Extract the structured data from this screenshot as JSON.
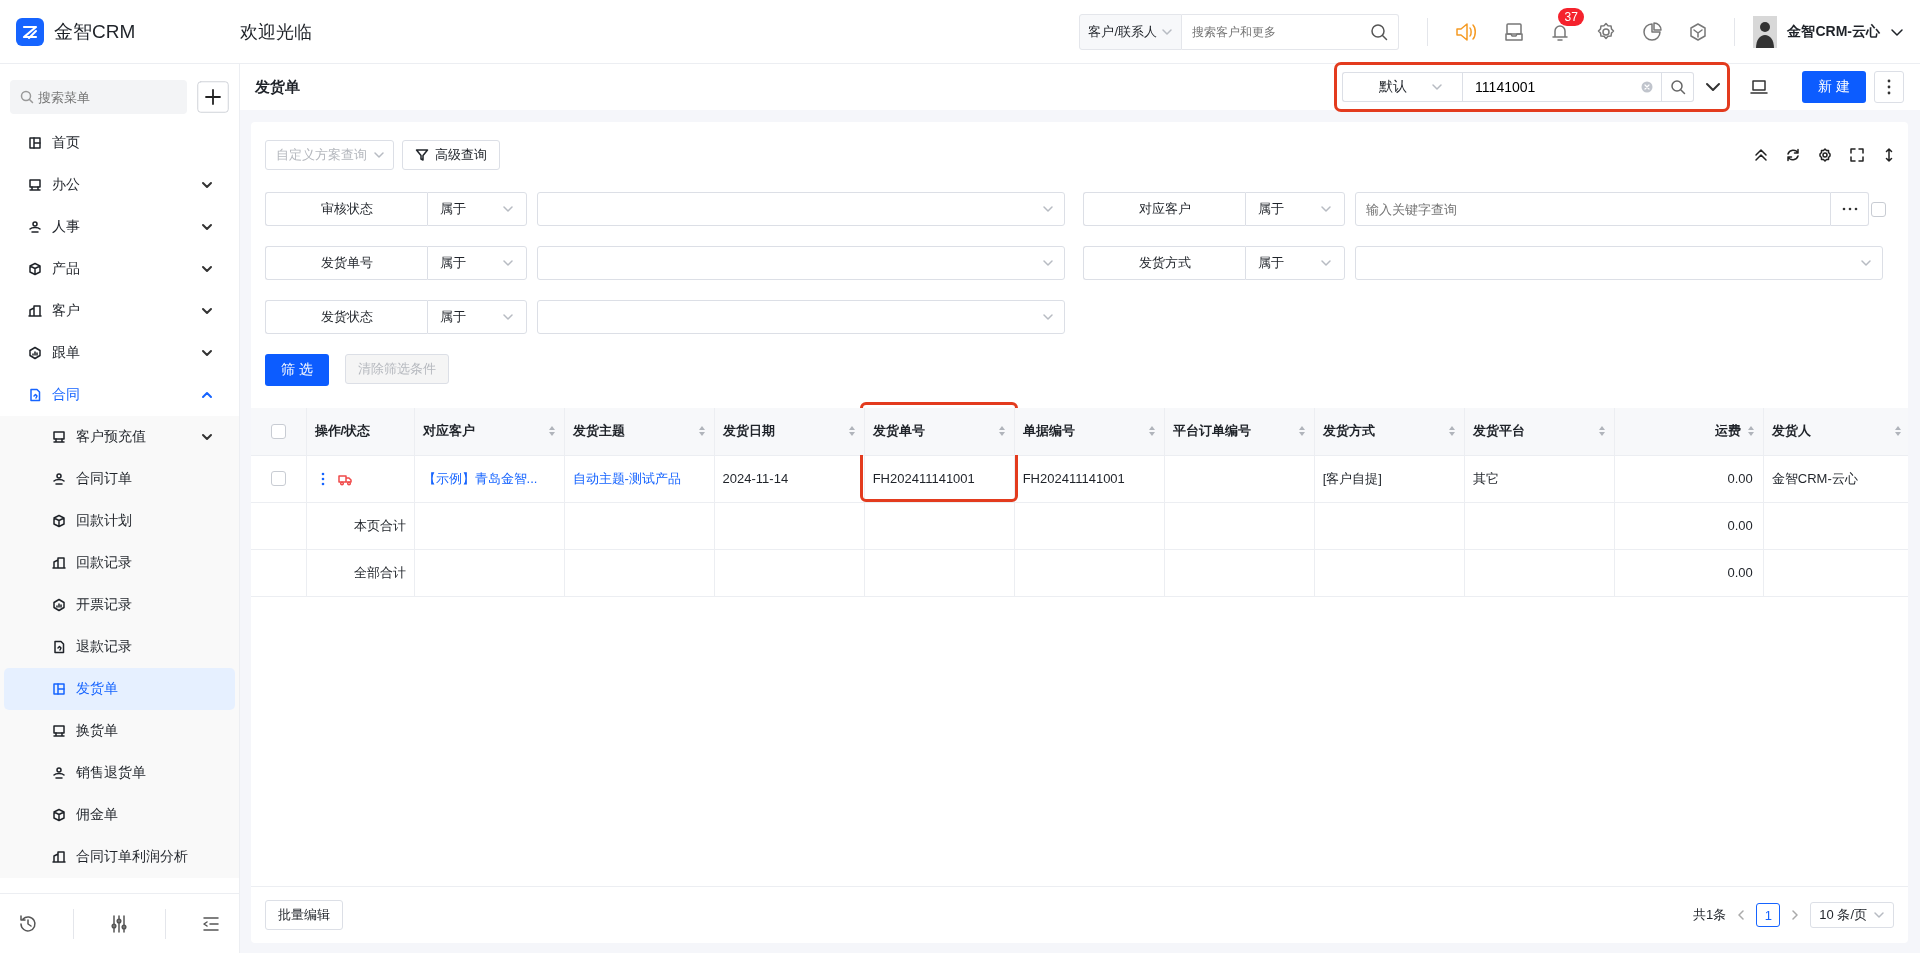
{
  "app": {
    "name": "金智CRM"
  },
  "header": {
    "greeting": "欢迎光临",
    "search_scope": "客户/联系人",
    "search_placeholder": "搜索客户和更多",
    "notification_count": "37",
    "user": "金智CRM-云心"
  },
  "sidebar": {
    "search_placeholder": "搜索菜单",
    "items": [
      {
        "label": "首页",
        "selected": false
      },
      {
        "label": "办公",
        "selected": false,
        "expanded": false
      },
      {
        "label": "人事",
        "selected": false,
        "expanded": false
      },
      {
        "label": "产品",
        "selected": false,
        "expanded": false
      },
      {
        "label": "客户",
        "selected": false,
        "expanded": false
      },
      {
        "label": "跟单",
        "selected": false,
        "expanded": false
      },
      {
        "label": "合同",
        "selected": false,
        "expanded": true,
        "children": [
          {
            "label": "客户预充值",
            "selected": false,
            "expanded": false
          },
          {
            "label": "合同订单",
            "selected": false
          },
          {
            "label": "回款计划",
            "selected": false
          },
          {
            "label": "回款记录",
            "selected": false
          },
          {
            "label": "开票记录",
            "selected": false
          },
          {
            "label": "退款记录",
            "selected": false
          },
          {
            "label": "发货单",
            "selected": true
          },
          {
            "label": "换货单",
            "selected": false
          },
          {
            "label": "销售退货单",
            "selected": false
          },
          {
            "label": "佣金单",
            "selected": false
          },
          {
            "label": "合同订单利润分析",
            "selected": false
          }
        ]
      }
    ]
  },
  "page": {
    "title": "发货单",
    "view": "默认",
    "quick_search": "11141001",
    "quick_search_highlighted": true,
    "new_button": "新 建"
  },
  "filter": {
    "scheme_placeholder": "自定义方案查询",
    "advanced_button": "高级查询",
    "conditions": [
      {
        "kind": "select",
        "field": "审核状态",
        "operator": "属于"
      },
      {
        "kind": "keyword",
        "field": "对应客户",
        "operator": "属于",
        "placeholder": "输入关键字查询",
        "checked": false
      },
      {
        "kind": "select",
        "field": "发货单号",
        "operator": "属于"
      },
      {
        "kind": "select",
        "field": "发货方式",
        "operator": "属于"
      },
      {
        "kind": "select",
        "field": "发货状态",
        "operator": "属于"
      }
    ],
    "apply_button": "筛 选",
    "clear_button": {
      "label": "清除筛选条件",
      "disabled": true
    }
  },
  "table": {
    "columns": [
      {
        "label": "操作/状态",
        "sortable": false,
        "highlighted": false
      },
      {
        "label": "对应客户",
        "sortable": true,
        "highlighted": false
      },
      {
        "label": "发货主题",
        "sortable": true,
        "highlighted": false
      },
      {
        "label": "发货日期",
        "sortable": true,
        "highlighted": false
      },
      {
        "label": "发货单号",
        "sortable": true,
        "highlighted": true
      },
      {
        "label": "单据编号",
        "sortable": true,
        "highlighted": false
      },
      {
        "label": "平台订单编号",
        "sortable": true,
        "highlighted": false
      },
      {
        "label": "发货方式",
        "sortable": true,
        "highlighted": false
      },
      {
        "label": "发货平台",
        "sortable": true,
        "highlighted": false
      },
      {
        "label": "运费",
        "sortable": true,
        "highlighted": false,
        "kind": "number"
      },
      {
        "label": "发货人",
        "sortable": true,
        "highlighted": false
      }
    ],
    "all_checked": false,
    "rows": [
      {
        "checked": false,
        "cells": [
          {
            "kind": "actions"
          },
          {
            "kind": "link",
            "text": "【示例】青岛金智..."
          },
          {
            "kind": "link",
            "text": "自动主题-测试产品"
          },
          {
            "kind": "text",
            "text": "2024-11-14"
          },
          {
            "kind": "text",
            "text": "FH202411141001"
          },
          {
            "kind": "text",
            "text": "FH202411141001"
          },
          {
            "kind": "empty"
          },
          {
            "kind": "text",
            "text": "[客户自提]"
          },
          {
            "kind": "text",
            "text": "其它"
          },
          {
            "kind": "text",
            "text": "0.00"
          },
          {
            "kind": "text",
            "text": "金智CRM-云心"
          }
        ]
      }
    ],
    "summaries": [
      {
        "label": "本页合计",
        "freight": "0.00"
      },
      {
        "label": "全部合计",
        "freight": "0.00"
      }
    ]
  },
  "footer": {
    "batch_button": "批量编辑",
    "total": "共1条",
    "pages": [
      {
        "label": "1",
        "selected": true
      }
    ],
    "page_size": "10 条/页"
  }
}
